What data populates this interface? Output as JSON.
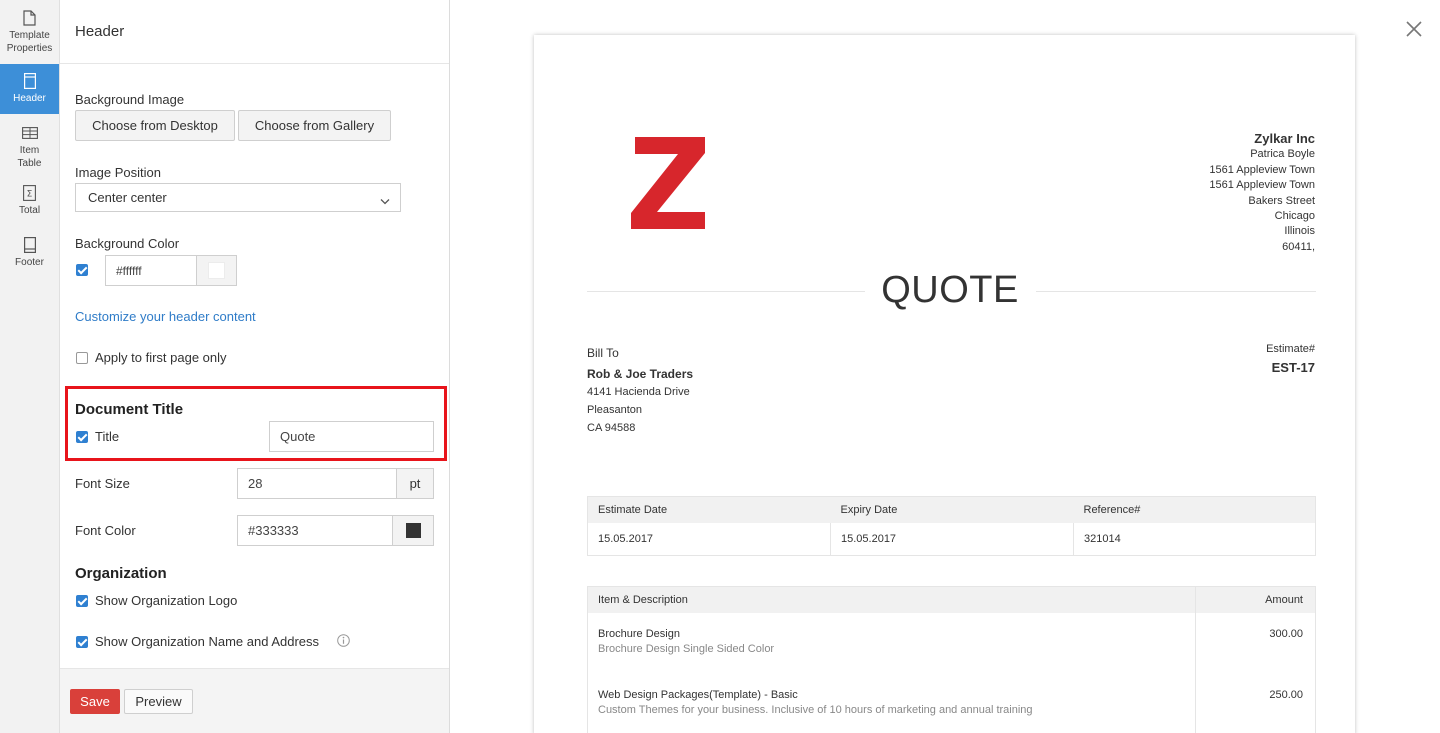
{
  "rail": {
    "items": [
      {
        "label": "Template\nProperties",
        "icon": "document-icon",
        "active": false
      },
      {
        "label": "Header",
        "icon": "header-icon",
        "active": true
      },
      {
        "label": "Item\nTable",
        "icon": "table-icon",
        "active": false
      },
      {
        "label": "Total",
        "icon": "sigma-icon",
        "active": false
      },
      {
        "label": "Footer",
        "icon": "footer-icon",
        "active": false
      }
    ]
  },
  "panel": {
    "title": "Header",
    "background_image": {
      "label": "Background Image",
      "desktop_btn": "Choose from Desktop",
      "gallery_btn": "Choose from Gallery"
    },
    "image_position": {
      "label": "Image Position",
      "value": "Center center"
    },
    "background_color": {
      "label": "Background Color",
      "enabled": true,
      "value": "#ffffff",
      "swatch": "#ffffff"
    },
    "customize_link": "Customize your header content",
    "apply_first_page": {
      "label": "Apply to first page only",
      "checked": false
    },
    "document_title": {
      "heading": "Document Title",
      "title_label": "Title",
      "title_checked": true,
      "title_value": "Quote"
    },
    "font_size": {
      "label": "Font Size",
      "value": "28",
      "unit": "pt"
    },
    "font_color": {
      "label": "Font Color",
      "value": "#333333",
      "swatch": "#333333"
    },
    "organization": {
      "heading": "Organization",
      "show_logo": {
        "label": "Show Organization Logo",
        "checked": true
      },
      "show_name_address": {
        "label": "Show Organization Name and Address",
        "checked": true
      }
    },
    "footer": {
      "save": "Save",
      "preview": "Preview"
    }
  },
  "document": {
    "logo_color": "#d7262c",
    "org": {
      "name": "Zylkar Inc",
      "lines": [
        "Patrica Boyle",
        "1561 Appleview Town",
        "1561 Appleview Town",
        "Bakers Street",
        "Chicago",
        "Illinois",
        "60411,"
      ]
    },
    "title": "QUOTE",
    "bill_to": {
      "label": "Bill To",
      "name": "Rob & Joe Traders",
      "lines": [
        "4141 Hacienda Drive",
        "Pleasanton",
        "CA 94588"
      ]
    },
    "estimate": {
      "label": "Estimate#",
      "value": "EST-17"
    },
    "info_table": {
      "headers": [
        "Estimate Date",
        "Expiry Date",
        "Reference#"
      ],
      "values": [
        "15.05.2017",
        "15.05.2017",
        "321014"
      ]
    },
    "item_table": {
      "headers": [
        "Item & Description",
        "Amount"
      ],
      "rows": [
        {
          "name": "Brochure Design",
          "desc": "Brochure Design Single Sided Color",
          "amount": "300.00"
        },
        {
          "name": "Web Design Packages(Template) - Basic",
          "desc": "Custom Themes for your business. Inclusive of 10 hours of marketing and annual training",
          "amount": "250.00"
        }
      ]
    }
  }
}
